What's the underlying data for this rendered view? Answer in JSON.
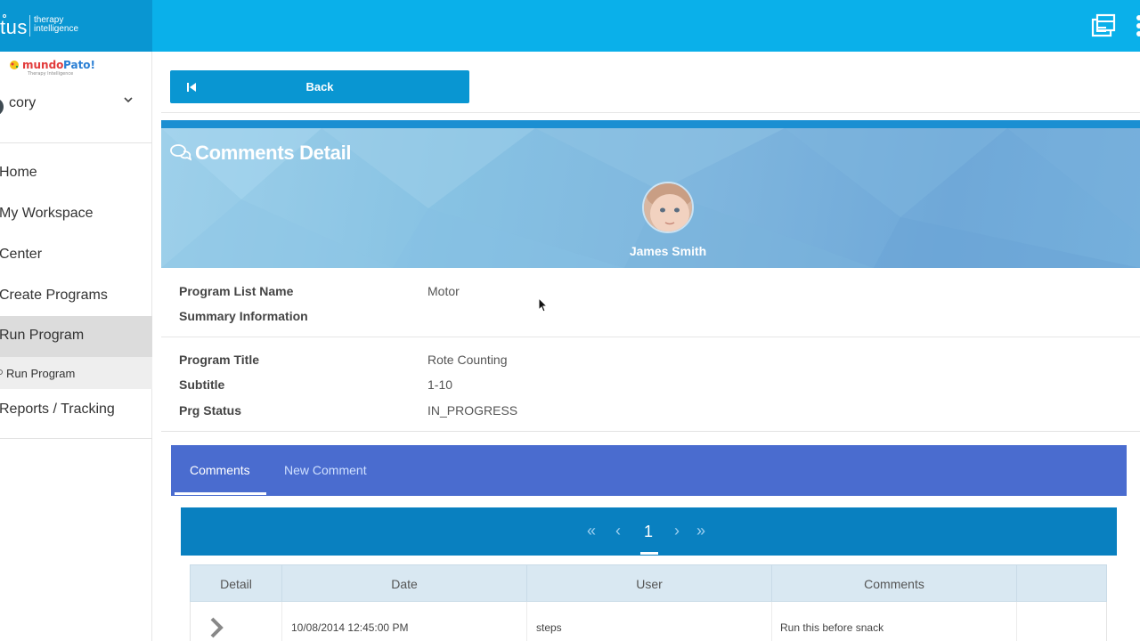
{
  "header": {
    "brand_text": "tus",
    "brand_sub_1": "therapy",
    "brand_sub_2": "intelligence",
    "icons": [
      "windows-icon",
      "more-icon"
    ]
  },
  "sidebar": {
    "logo_text": "mundo Pato!",
    "logo_sub": "Therapy Intelligence",
    "user_name": "cory",
    "items": [
      {
        "label": "Home"
      },
      {
        "label": "My Workspace"
      },
      {
        "label": "Center"
      },
      {
        "label": "Create Programs"
      },
      {
        "label": "Run Program",
        "active": true
      },
      {
        "label": "Reports / Tracking"
      }
    ],
    "sub_item": "Run Program"
  },
  "actions": {
    "back_label": "Back"
  },
  "detail": {
    "title": "Comments Detail",
    "patient_name": "James Smith",
    "fields": [
      {
        "label": "Program List Name",
        "value": "Motor"
      },
      {
        "label": "Summary Information",
        "value": ""
      },
      {
        "label": "Program Title",
        "value": "Rote Counting"
      },
      {
        "label": "Subtitle",
        "value": "1-10"
      },
      {
        "label": "Prg Status",
        "value": "IN_PROGRESS"
      }
    ]
  },
  "tabs": [
    {
      "label": "Comments",
      "active": true
    },
    {
      "label": "New Comment",
      "active": false
    }
  ],
  "pager": {
    "first": "«",
    "prev": "‹",
    "current": "1",
    "next": "›",
    "last": "»"
  },
  "table": {
    "columns": [
      "Detail",
      "Date",
      "User",
      "Comments",
      ""
    ],
    "rows": [
      {
        "date": "10/08/2014 12:45:00 PM",
        "user": "steps",
        "comments": "Run this before snack"
      }
    ]
  },
  "colors": {
    "header": "#0ab0ea",
    "brand_block": "#0996d2",
    "tabs": "#4a6ccf",
    "pager": "#0980c0",
    "table_head": "#d9e8f2"
  }
}
